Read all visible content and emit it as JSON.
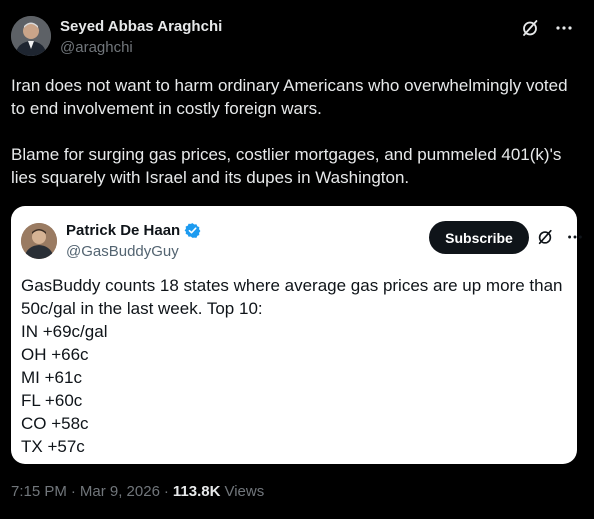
{
  "author": {
    "name": "Seyed Abbas Araghchi",
    "handle": "@araghchi"
  },
  "post": {
    "paragraphs": [
      "Iran does not want to harm ordinary Americans who overwhelmingly voted to end involvement in costly foreign wars.",
      "Blame for surging gas prices, costlier mortgages, and pummeled 401(k)'s lies squarely with Israel and its dupes in Washington."
    ]
  },
  "quoted": {
    "name": "Patrick De Haan",
    "handle": "@GasBuddyGuy",
    "subscribe_label": "Subscribe",
    "lines": [
      "GasBuddy counts 18 states where average gas prices are up more than 50c/gal in the last week. Top 10:",
      "IN +69c/gal",
      "OH +66c",
      "MI +61c",
      "FL +60c",
      "CO +58c",
      "TX +57c"
    ]
  },
  "meta": {
    "time": "7:15 PM",
    "separator": "·",
    "date": "Mar 9, 2026",
    "separator2": "·",
    "views_count": "113.8K",
    "views_label": "Views"
  },
  "icons": {
    "grok": "grok-slash-icon",
    "more": "more-horizontal-icon",
    "verified": "verified-badge-icon"
  },
  "colors": {
    "background": "#000000",
    "text": "#e7e9ea",
    "muted": "#71767b",
    "verified": "#1d9bf0",
    "card": "#ffffff"
  }
}
